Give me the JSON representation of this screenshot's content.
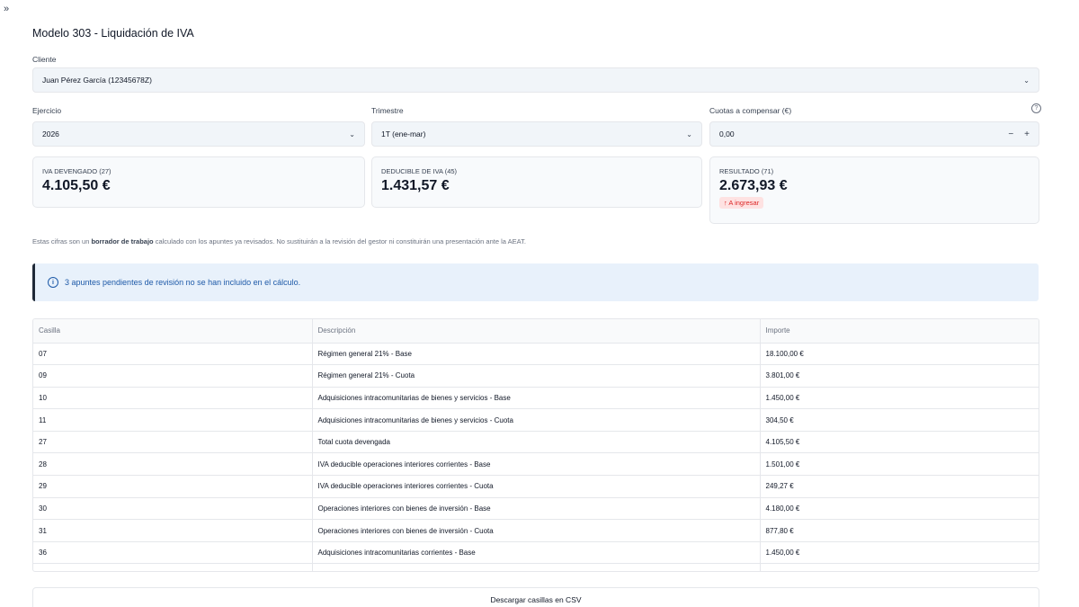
{
  "nav": {
    "collapse_icon": "»"
  },
  "page": {
    "title": "Modelo 303 - Liquidación de IVA"
  },
  "cliente": {
    "label": "Cliente",
    "value": "Juan Pérez García (12345678Z)"
  },
  "ejercicio": {
    "label": "Ejercicio",
    "value": "2026"
  },
  "trimestre": {
    "label": "Trimestre",
    "value": "1T (ene-mar)"
  },
  "cuotas": {
    "label": "Cuotas a compensar (€)",
    "value": "0,00",
    "minus": "−",
    "plus": "+"
  },
  "cards": {
    "devengado": {
      "label": "IVA DEVENGADO (27)",
      "value": "4.105,50 €"
    },
    "deducible": {
      "label": "DEDUCIBLE DE IVA (45)",
      "value": "1.431,57 €"
    },
    "resultado": {
      "label": "RESULTADO (71)",
      "value": "2.673,93 €",
      "badge": "↑ A ingresar",
      "badge_color": "#dc2626"
    }
  },
  "note": {
    "prefix": "Estas cifras son un ",
    "bold": "borrador de trabajo",
    "suffix": " calculado con los apuntes ya revisados. No sustituirán a la revisión del gestor ni constituirán una presentación ante la AEAT."
  },
  "alert": {
    "text": "3 apuntes pendientes de revisión no se han incluido en el cálculo.",
    "color": "#1e5aa8"
  },
  "table": {
    "headers": [
      "Casilla",
      "Descripción",
      "Importe"
    ],
    "rows": [
      [
        "07",
        "Régimen general 21% - Base",
        "18.100,00 €"
      ],
      [
        "09",
        "Régimen general 21% - Cuota",
        "3.801,00 €"
      ],
      [
        "10",
        "Adquisiciones intracomunitarias de bienes y servicios - Base",
        "1.450,00 €"
      ],
      [
        "11",
        "Adquisiciones intracomunitarias de bienes y servicios - Cuota",
        "304,50 €"
      ],
      [
        "27",
        "Total cuota devengada",
        "4.105,50 €"
      ],
      [
        "28",
        "IVA deducible operaciones interiores corrientes - Base",
        "1.501,00 €"
      ],
      [
        "29",
        "IVA deducible operaciones interiores corrientes - Cuota",
        "249,27 €"
      ],
      [
        "30",
        "Operaciones interiores con bienes de inversión - Base",
        "4.180,00 €"
      ],
      [
        "31",
        "Operaciones interiores con bienes de inversión - Cuota",
        "877,80 €"
      ],
      [
        "36",
        "Adquisiciones intracomunitarias corrientes - Base",
        "1.450,00 €"
      ]
    ]
  },
  "download": {
    "label": "Descargar casillas en CSV"
  }
}
